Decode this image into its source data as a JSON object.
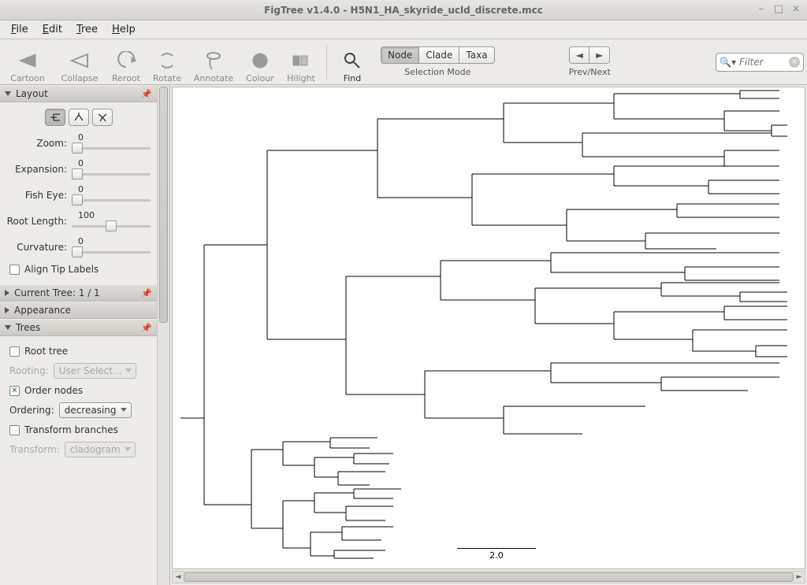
{
  "window": {
    "title": "FigTree v1.4.0 - H5N1_HA_skyride_ucld_discrete.mcc"
  },
  "menus": {
    "file": "File",
    "edit": "Edit",
    "tree": "Tree",
    "help": "Help"
  },
  "toolbar": {
    "cartoon": "Cartoon",
    "collapse": "Collapse",
    "reroot": "Reroot",
    "rotate": "Rotate",
    "annotate": "Annotate",
    "colour": "Colour",
    "hilight": "Hilight",
    "find": "Find",
    "node": "Node",
    "clade": "Clade",
    "taxa": "Taxa",
    "selmode": "Selection Mode",
    "prevnext": "Prev/Next"
  },
  "search": {
    "placeholder": "Filter"
  },
  "panels": {
    "layout": {
      "title": "Layout",
      "zoom_label": "Zoom:",
      "zoom_value": "0",
      "expansion_label": "Expansion:",
      "expansion_value": "0",
      "fisheye_label": "Fish Eye:",
      "fisheye_value": "0",
      "rootlength_label": "Root Length:",
      "rootlength_value": "100",
      "curvature_label": "Curvature:",
      "curvature_value": "0",
      "align_tips": "Align Tip Labels"
    },
    "current_tree": {
      "title": "Current Tree: 1 / 1"
    },
    "appearance": {
      "title": "Appearance"
    },
    "trees": {
      "title": "Trees",
      "root_tree": "Root tree",
      "rooting_label": "Rooting:",
      "rooting_value": "User Select...",
      "order_nodes": "Order nodes",
      "ordering_label": "Ordering:",
      "ordering_value": "decreasing",
      "transform_branches": "Transform branches",
      "transform_label": "Transform:",
      "transform_value": "cladogram"
    }
  },
  "canvas": {
    "scale_label": "2.0"
  }
}
